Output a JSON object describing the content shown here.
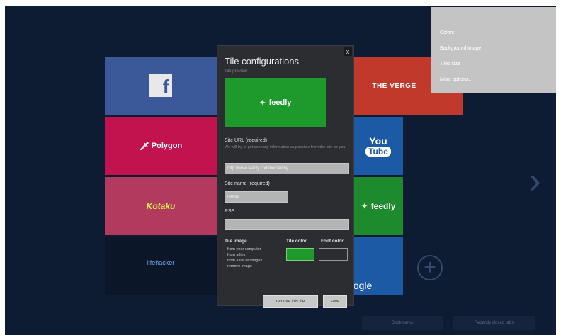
{
  "tiles": {
    "facebook": {
      "label": "f",
      "color": "#3b5998"
    },
    "polygon": {
      "label": "Polygon",
      "icon": "polygon-logo-icon",
      "color": "#c2134f"
    },
    "kotaku": {
      "label": "Kotaku",
      "color": "#b33a5f"
    },
    "lifehacker": {
      "label": "lifehacker",
      "color": "#0b1628"
    },
    "verge": {
      "label": "THE VERGE",
      "color": "#c0392b"
    },
    "youtube": {
      "you": "You",
      "tube": "Tube",
      "color": "#1c5aa6"
    },
    "feedly": {
      "label": "feedly",
      "icon": "feedly-leaf-icon",
      "color": "#1e8a2e"
    },
    "google": {
      "label": "oogle",
      "color": "#1c5aa6"
    }
  },
  "dialog": {
    "title": "Tile configurations",
    "preview_label": "Tile preview",
    "preview_text": "feedly",
    "site_url_label": "Site URL (required)",
    "site_url_hint": "We will try to get as many information as possible from the site for you",
    "site_url_value": "http://www.feedly.com/home#my",
    "site_name_label": "Site name (required)",
    "site_name_value": "feedly",
    "rss_label": "RSS",
    "rss_value": "",
    "tile_image_label": "Tile image",
    "image_options": [
      "from your computer",
      "from a link",
      "from a list of images",
      "remove image"
    ],
    "tile_color_label": "Tile color",
    "tile_color_value": "#1e9a2d",
    "font_color_label": "Font color",
    "remove_label": "remove this tile",
    "save_label": "save",
    "close_label": "x"
  },
  "settings_menu": {
    "items": [
      "Colors",
      "Background image",
      "Tiles size",
      "More options..."
    ]
  },
  "bottom_bar": {
    "buttons": [
      "Bookmarks",
      "Recently closed tabs"
    ]
  }
}
